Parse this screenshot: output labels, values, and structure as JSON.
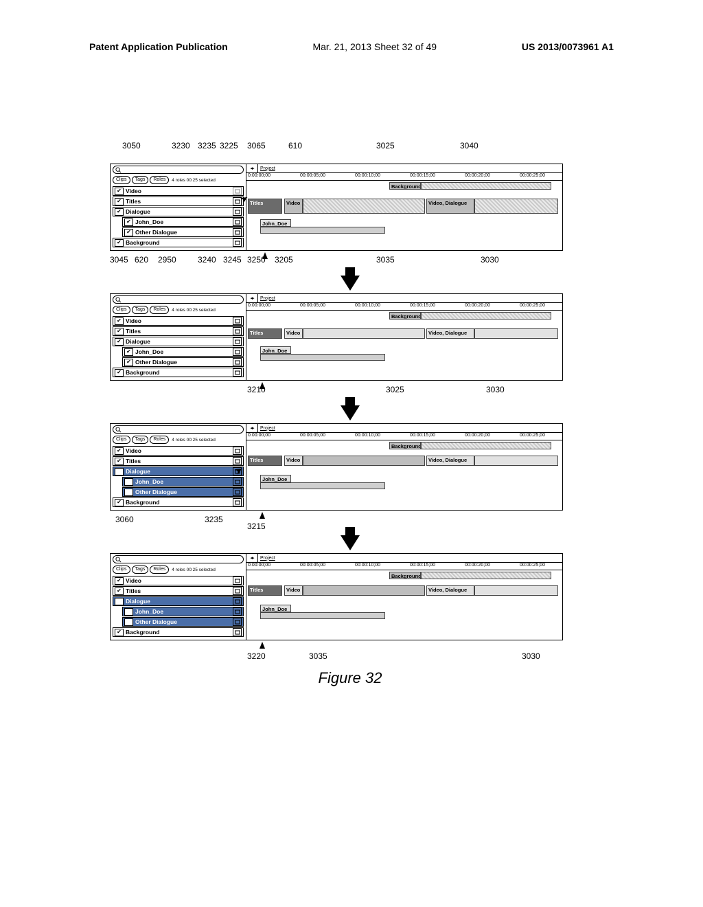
{
  "header": {
    "left": "Patent Application Publication",
    "center": "Mar. 21, 2013  Sheet 32 of 49",
    "right": "US 2013/0073961 A1"
  },
  "figure_caption": "Figure 32",
  "sidebar": {
    "pills": {
      "clips": "Clips",
      "tags": "Tags",
      "roles": "Roles"
    },
    "status": "4 roles 00:25 selected",
    "roles": {
      "video": "Video",
      "titles": "Titles",
      "dialogue": "Dialogue",
      "john_doe": "John_Doe",
      "other_dialogue": "Other Dialogue",
      "background": "Background"
    }
  },
  "timeline": {
    "project": "Project",
    "ticks": [
      "0:00:00;00",
      "00:00:05;00",
      "00:00:10;00",
      "00:00:15;00",
      "00:00:20;00",
      "00:00:25;00"
    ],
    "clips": {
      "background": "Background",
      "titles": "Titles",
      "video": "Video",
      "video_dialogue": "Video, Dialogue",
      "john_doe": "John_Doe"
    }
  },
  "refs_top": {
    "r1": "3050",
    "r2": "3230",
    "r3": "3235",
    "r4": "3225",
    "r5": "3065",
    "r6": "610",
    "r7": "3025",
    "r8": "3040"
  },
  "refs_row1": {
    "a": "3045",
    "b": "620",
    "c": "2950",
    "d": "3240",
    "e": "3245",
    "f": "3250",
    "g": "3205",
    "h": "3035",
    "i": "3030"
  },
  "refs_row2": {
    "a": "3210",
    "b": "3025",
    "c": "3030"
  },
  "refs_row3": {
    "a": "3060",
    "b": "3235",
    "c": "3215"
  },
  "refs_row4": {
    "a": "3220",
    "b": "3035",
    "c": "3030"
  }
}
